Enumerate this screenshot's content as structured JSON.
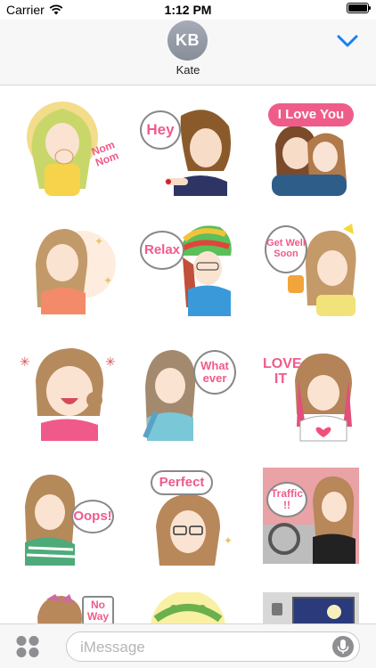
{
  "status_bar": {
    "carrier": "Carrier",
    "time": "1:12 PM",
    "battery_level": 1.0,
    "battery_label": ""
  },
  "header": {
    "avatar_initials": "KB",
    "contact_name": "Kate",
    "collapse_icon": "chevron-down-icon",
    "accent_color": "#1a7ef7"
  },
  "stickers": [
    {
      "name": "nom-nom",
      "label": "Nom Nom"
    },
    {
      "name": "hey",
      "label": "Hey"
    },
    {
      "name": "i-love-you",
      "label": "I Love You"
    },
    {
      "name": "wink",
      "label": ""
    },
    {
      "name": "relax",
      "label": "Relax"
    },
    {
      "name": "get-well-soon",
      "label": "Get Well Soon"
    },
    {
      "name": "laughing",
      "label": ""
    },
    {
      "name": "whatever",
      "label": "What ever"
    },
    {
      "name": "love-it",
      "label": "LOVE IT"
    },
    {
      "name": "oops",
      "label": "Oops!"
    },
    {
      "name": "perfect",
      "label": "Perfect"
    },
    {
      "name": "traffic",
      "label": "Traffic !!"
    },
    {
      "name": "no-way",
      "label": "No Way"
    },
    {
      "name": "flower-crown",
      "label": ""
    },
    {
      "name": "night-window",
      "label": ""
    }
  ],
  "input_bar": {
    "placeholder": "iMessage",
    "apps_icon": "app-drawer-icon",
    "mic_icon": "microphone-icon"
  }
}
